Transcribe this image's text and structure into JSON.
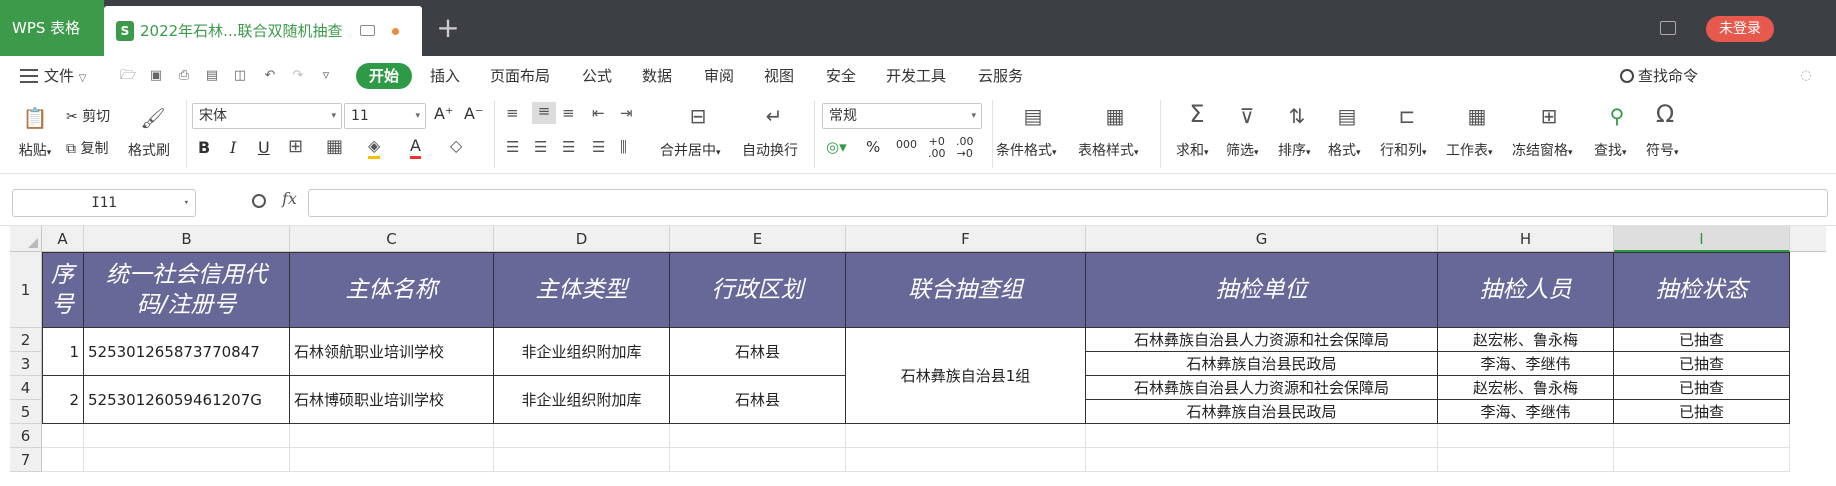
{
  "titlebar": {
    "app_name": "WPS 表格",
    "doc_badge": "S",
    "doc_title": "2022年石林...联合双随机抽查",
    "new_tab": "+",
    "login_label": "未登录"
  },
  "menubar": {
    "file_label": "文件",
    "tabs": [
      "开始",
      "插入",
      "页面布局",
      "公式",
      "数据",
      "审阅",
      "视图",
      "安全",
      "开发工具",
      "云服务"
    ],
    "search_label": "查找命令"
  },
  "ribbon": {
    "paste_label": "粘贴",
    "cut_label": "剪切",
    "copy_label": "复制",
    "format_painter_label": "格式刷",
    "font_name": "宋体",
    "font_size": "11",
    "bold": "B",
    "italic": "I",
    "underline": "U",
    "merge_label": "合并居中",
    "wrap_label": "自动换行",
    "number_format": "常规",
    "percent": "%",
    "thousands": "000",
    "cond_format_label": "条件格式",
    "table_style_label": "表格样式",
    "sum_label": "求和",
    "filter_label": "筛选",
    "sort_label": "排序",
    "format_label": "格式",
    "rowcol_label": "行和列",
    "sheet_label": "工作表",
    "freeze_label": "冻结窗格",
    "find_label": "查找",
    "symbol_label": "符号"
  },
  "formula": {
    "cell_ref": "I11",
    "fx": "fx",
    "value": ""
  },
  "sheet": {
    "columns": [
      "A",
      "B",
      "C",
      "D",
      "E",
      "F",
      "G",
      "H",
      "I"
    ],
    "selected_column": "I",
    "rows": [
      "1",
      "2",
      "3",
      "4",
      "5",
      "6",
      "7"
    ],
    "headers": {
      "a": "序号",
      "b": "统一社会信用代码/注册号",
      "c": "主体名称",
      "d": "主体类型",
      "e": "行政区划",
      "f": "联合抽查组",
      "g": "抽检单位",
      "h": "抽检人员",
      "i": "抽检状态"
    },
    "entities": [
      {
        "no": "1",
        "code": "52530126587377084​7",
        "name": "石林领航职业培训学校",
        "type": "非企业组织附加库",
        "region": "石林县"
      },
      {
        "no": "2",
        "code": "52530126059461207G",
        "name": "石林博硕职业培训学校",
        "type": "非企业组织附加库",
        "region": "石林县"
      }
    ],
    "group": "石林彝族自治县1组",
    "inspections": [
      {
        "unit": "石林彝族自治县人力资源和社会保障局",
        "staff": "赵宏彬、鲁永梅",
        "status": "已抽查"
      },
      {
        "unit": "石林彝族自治县民政局",
        "staff": "李海、李继伟",
        "status": "已抽查"
      },
      {
        "unit": "石林彝族自治县人力资源和社会保障局",
        "staff": "赵宏彬、鲁永梅",
        "status": "已抽查"
      },
      {
        "unit": "石林彝族自治县民政局",
        "staff": "李海、李继伟",
        "status": "已抽查"
      }
    ]
  },
  "colors": {
    "accent": "#2e9a45",
    "header_fill": "#676798",
    "login": "#e7594d"
  }
}
